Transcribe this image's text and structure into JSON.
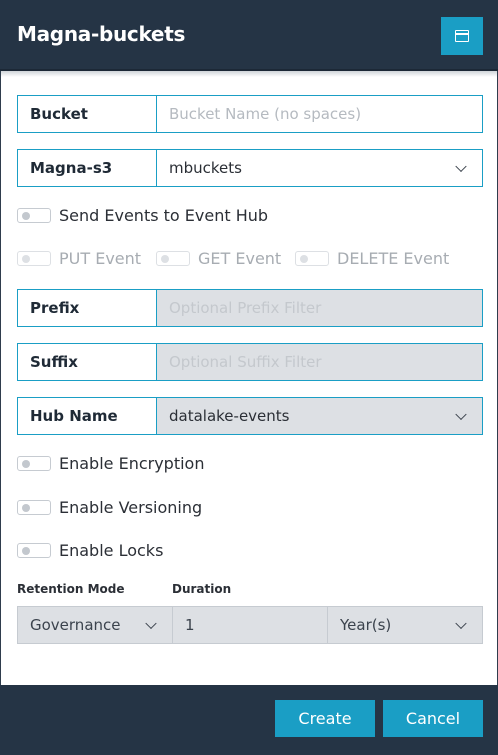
{
  "header": {
    "title": "Magna-buckets",
    "window_icon": "window-icon"
  },
  "bucket": {
    "label": "Bucket",
    "placeholder": "Bucket Name (no spaces)",
    "value": ""
  },
  "storage": {
    "label": "Magna-s3",
    "selected": "mbuckets"
  },
  "event_hub": {
    "label": "Send Events to Event Hub",
    "enabled": false,
    "put_label": "PUT Event",
    "get_label": "GET Event",
    "delete_label": "DELETE Event"
  },
  "prefix": {
    "label": "Prefix",
    "placeholder": "Optional Prefix Filter"
  },
  "suffix": {
    "label": "Suffix",
    "placeholder": "Optional Suffix Filter"
  },
  "hub": {
    "label": "Hub Name",
    "selected": "datalake-events"
  },
  "options": {
    "encryption_label": "Enable Encryption",
    "versioning_label": "Enable Versioning",
    "locks_label": "Enable Locks"
  },
  "retention": {
    "mode_label": "Retention Mode",
    "duration_label": "Duration",
    "mode_value": "Governance",
    "duration_value": "1",
    "unit_value": "Year(s)"
  },
  "footer": {
    "create_label": "Create",
    "cancel_label": "Cancel"
  },
  "colors": {
    "header_bg": "#253445",
    "accent": "#1a9ec5",
    "disabled_bg": "#dde0e4"
  }
}
